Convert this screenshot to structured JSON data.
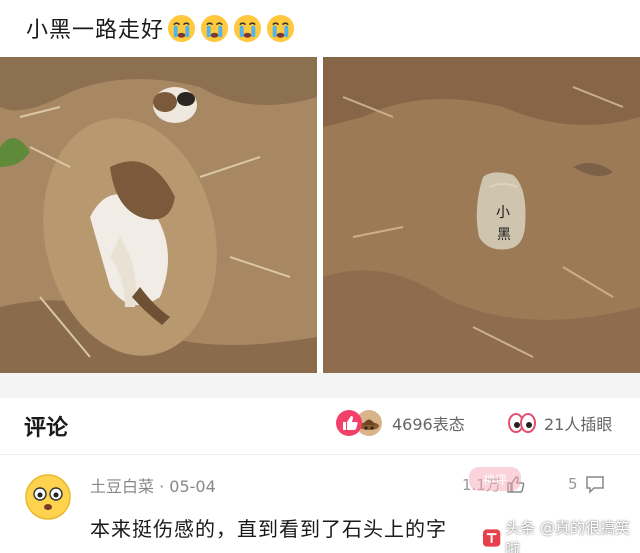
{
  "post": {
    "title": "小黑一路走好",
    "emoji": [
      "sad-face-icon",
      "sad-face-icon",
      "sad-face-icon",
      "sad-face-icon"
    ],
    "stone_text": "小黑"
  },
  "comments_section": {
    "title": "评论",
    "reactions": {
      "count_label": "4696表态",
      "icons": [
        "like-icon",
        "hat-icon"
      ]
    },
    "inserts": {
      "count_label": "21人插眼",
      "icon": "eyes-icon"
    }
  },
  "comment": {
    "user": "土豆白菜 · 05-04",
    "likes": "1.1万",
    "replies": "5",
    "text": "本来挺伤感的，直到看到了石头上的字",
    "watermark": "头条 @真的很搞笑啦"
  },
  "colors": {
    "accent": "#f3406b",
    "soil": "#9c7a55",
    "background": "#ffffff"
  }
}
